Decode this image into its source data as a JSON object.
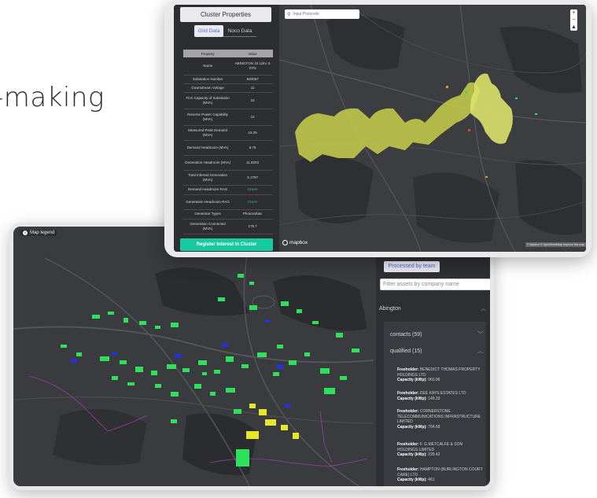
{
  "headline": "-making",
  "back_view": {
    "legend_label": "Map legend",
    "processed_tab": "Processed by team",
    "filter_placeholder": "Filter assets by company name",
    "group": "Abington",
    "contacts": "contacts (59)",
    "qualified": "qualified (15)",
    "freeholder_label": "Freeholder:",
    "capacity_label": "Capacity (kWp):",
    "owners": [
      {
        "name": "BENEDICT THOMAS PROPERTY HOLDINGS LTD",
        "capacity": "960.96"
      },
      {
        "name": "DEE KAYS ESTATES LTD",
        "capacity": "149.33"
      },
      {
        "name": "CORNERSTONE TELECOMMUNICATIONS INFRASTRUCTURE LIMITED",
        "capacity": "704.68"
      },
      {
        "name": "F. G METCALFE & SON HOLDINGS LIMITED",
        "capacity": "199.42"
      },
      {
        "name": "HAMPTON (BURLINGTON COURT CARE) LTD",
        "capacity": "461"
      }
    ]
  },
  "front_view": {
    "panel_title": "Cluster Properties",
    "tabs": [
      "Grid Data",
      "Noco Data"
    ],
    "table_headers": [
      "Property",
      "Value"
    ],
    "rows": [
      {
        "k": "Name",
        "v": "ABINGTON 33 11kV S STN"
      },
      {
        "k": "Substation Number",
        "v": "940057"
      },
      {
        "k": "Downstream Voltage",
        "v": "11"
      },
      {
        "k": "Firm Capacity of Substation (MVA)",
        "v": "24"
      },
      {
        "k": "Reverse Power Capability (MVA)",
        "v": "12"
      },
      {
        "k": "Measured Peak Demand (MVA)",
        "v": "15.25"
      },
      {
        "k": "Demand Headroom (MVA)",
        "v": "8.75"
      },
      {
        "k": "Generation Headroom (MVA)",
        "v": "11.8203"
      },
      {
        "k": "Total Inferred Generation (MVA)",
        "v": "5.1797"
      },
      {
        "k": "Demand Headroom RAG",
        "v": "Green"
      },
      {
        "k": "Generation Headroom RAG",
        "v": "Green"
      },
      {
        "k": "Generator Types",
        "v": "Photovoltaic"
      },
      {
        "k": "Generation Connected (MVA)",
        "v": "179.7"
      }
    ],
    "register_button": "Register Interest in Cluster",
    "postcode_placeholder": "Input Postcode",
    "zoom_in": "+",
    "zoom_out": "−",
    "compass": "▲",
    "mapbox": "mapbox",
    "attribution": "© Mapbox © OpenStreetMap Improve this map"
  },
  "colors": {
    "accent": "#16c9a0",
    "tab_text": "#4b6bd8",
    "building_green": "#2ee05a",
    "building_blue": "#2233d9",
    "building_yellow": "#e6e62a",
    "cluster_fill": "#c8cf4a",
    "rag_green": "#3fb86a"
  }
}
